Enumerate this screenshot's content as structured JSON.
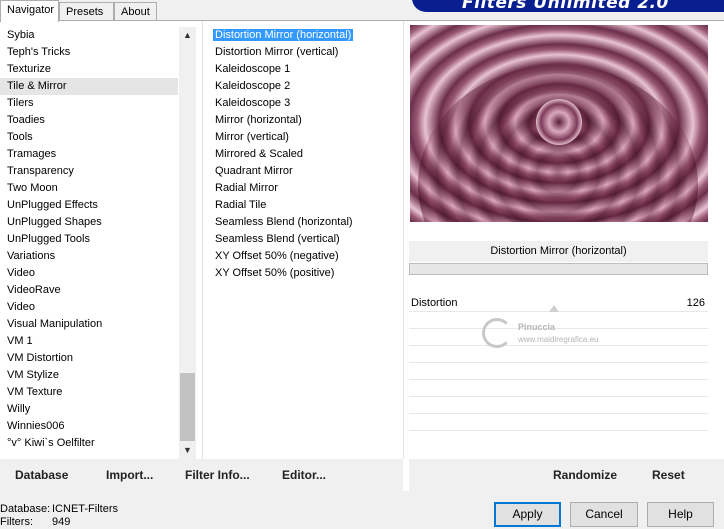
{
  "tabs": [
    {
      "label": "Navigator",
      "active": true
    },
    {
      "label": "Presets",
      "active": false
    },
    {
      "label": "About",
      "active": false
    }
  ],
  "app_title": "Filters Unlimited 2.0",
  "categories": [
    "Sybia",
    "Teph's Tricks",
    "Texturize",
    "Tile & Mirror",
    "Tilers",
    "Toadies",
    "Tools",
    "Tramages",
    "Transparency",
    "Two Moon",
    "UnPlugged Effects",
    "UnPlugged Shapes",
    "UnPlugged Tools",
    "Variations",
    "Video",
    "VideoRave",
    "Video",
    "Visual Manipulation",
    "VM 1",
    "VM Distortion",
    "VM Stylize",
    "VM Texture",
    "Willy",
    "Winnies006",
    "°v° Kiwi`s Oelfilter"
  ],
  "selected_category": "Tile & Mirror",
  "filters": [
    "Distortion Mirror (horizontal)",
    "Distortion Mirror (vertical)",
    "Kaleidoscope 1",
    "Kaleidoscope 2",
    "Kaleidoscope 3",
    "Mirror (horizontal)",
    "Mirror (vertical)",
    "Mirrored & Scaled",
    "Quadrant Mirror",
    "Radial Mirror",
    "Radial Tile",
    "Seamless Blend (horizontal)",
    "Seamless Blend (vertical)",
    "XY Offset 50% (negative)",
    "XY Offset 50% (positive)"
  ],
  "selected_filter": "Distortion Mirror (horizontal)",
  "filter_title": "Distortion Mirror (horizontal)",
  "parameters": [
    {
      "name": "Distortion",
      "value": "126"
    }
  ],
  "watermark": {
    "name": "Pinuccia",
    "url": "www.maidiregrafica.eu"
  },
  "actions": {
    "database": "Database",
    "import": "Import...",
    "filter_info": "Filter Info...",
    "editor": "Editor...",
    "randomize": "Randomize",
    "reset": "Reset"
  },
  "footer": {
    "database_label": "Database:",
    "database_value": "ICNET-Filters",
    "filters_label": "Filters:",
    "filters_value": "949"
  },
  "buttons": {
    "apply": "Apply",
    "cancel": "Cancel",
    "help": "Help"
  },
  "colors": {
    "selection": "#3399ff",
    "logo_bg": "#0a1f8f",
    "preview_tone": "#9a5a75"
  }
}
